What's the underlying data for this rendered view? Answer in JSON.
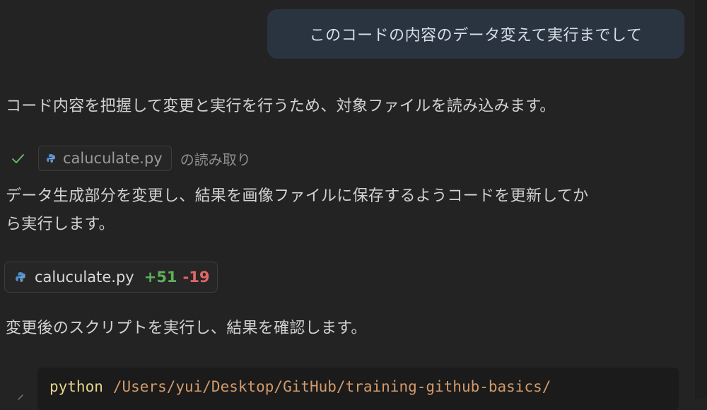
{
  "user_message": "このコードの内容のデータ変えて実行までして",
  "assistant": {
    "intro": "コード内容を把握して変更と実行を行うため、対象ファイルを読み込みます。",
    "read_action": {
      "file": "caluculate.py",
      "suffix": "の読み取り",
      "icon": "check-icon"
    },
    "plan_line1": "データ生成部分を変更し、結果を画像ファイルに保存するようコードを更新してか",
    "plan_line2": "ら実行します。",
    "edit": {
      "file": "caluculate.py",
      "added": "+51",
      "removed": "-19"
    },
    "run_intro": "変更後のスクリプトを実行し、結果を確認します。",
    "command": {
      "program": "python",
      "path": "/Users/yui/Desktop/GitHub/training-github-basics/"
    }
  },
  "colors": {
    "background": "#232323",
    "user_bubble": "#2a3441",
    "added": "#5fae5a",
    "removed": "#e06666",
    "check": "#6fbf6a",
    "python_icon": "#4f8fd1"
  }
}
